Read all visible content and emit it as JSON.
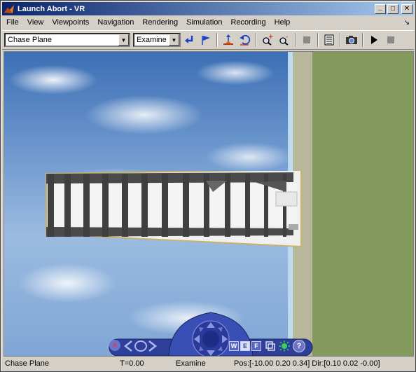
{
  "window": {
    "title": "Launch Abort - VR",
    "minimize_label": "_",
    "maximize_label": "□",
    "close_label": "✕"
  },
  "menu": {
    "items": [
      "File",
      "View",
      "Viewpoints",
      "Navigation",
      "Rendering",
      "Simulation",
      "Recording",
      "Help"
    ],
    "overflow_icon": "↘"
  },
  "toolbar": {
    "viewpoint_select": "Chase Plane",
    "navigation_mode_select": "Examine"
  },
  "navpanel": {
    "buttons": [
      "W",
      "E",
      "F"
    ],
    "help_label": "?"
  },
  "status": {
    "viewpoint": "Chase Plane",
    "time": "T=0.00",
    "mode": "Examine",
    "position": "Pos:[-10.00 0.20 0.34] Dir:[0.10 0.02 -0.00]"
  },
  "colors": {
    "titlebar_start": "#0a246a",
    "titlebar_end": "#a6caf0",
    "ground": "#849a5c",
    "sky": "#6a95cc",
    "nav_panel": "#2e3f9a"
  }
}
